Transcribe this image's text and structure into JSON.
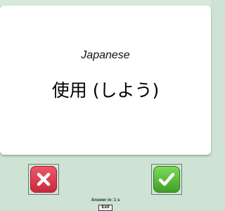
{
  "card": {
    "language": "Japanese",
    "word": "使用 (しよう)"
  },
  "buttons": {
    "wrong_icon": "x-icon",
    "right_icon": "check-icon",
    "wrong_color": "#d83446",
    "right_color": "#52b432"
  },
  "footer": {
    "answer_label": "Answer in: 1 s",
    "exit_label": "Exit"
  },
  "colors": {
    "background": "#cfe3d4",
    "card": "#ffffff"
  }
}
